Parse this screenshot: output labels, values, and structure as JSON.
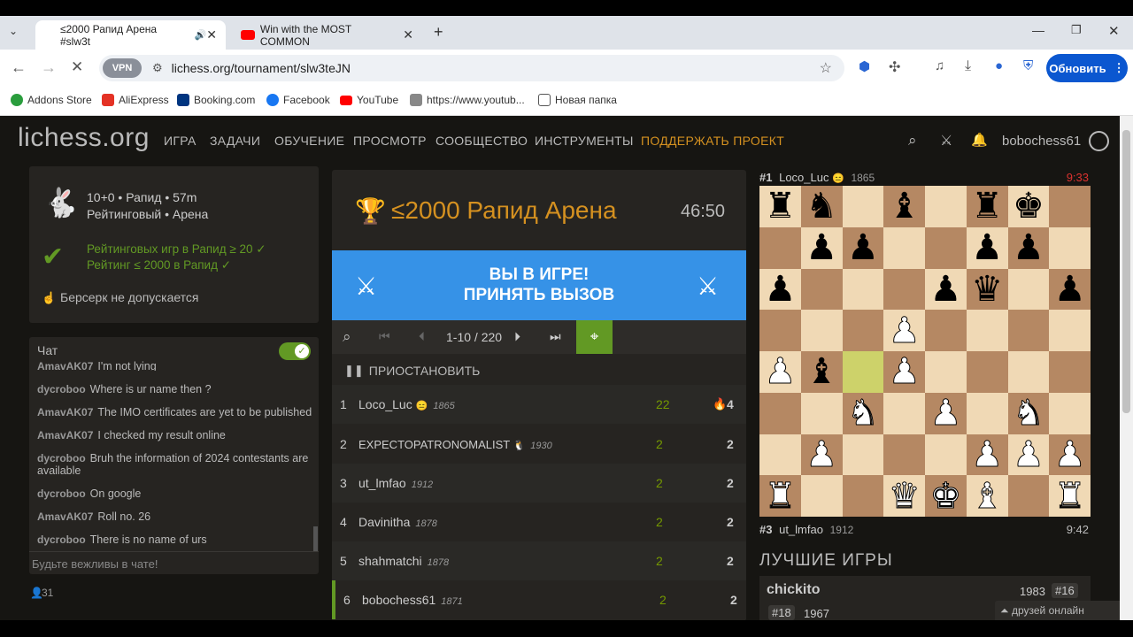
{
  "browser": {
    "tabs": [
      {
        "label": "≤2000 Рапид Арена #slw3t",
        "active": true
      },
      {
        "label": "Win with the MOST COMMON",
        "active": false
      }
    ],
    "url": "lichess.org/tournament/slw3teJN",
    "vpn": "VPN",
    "update_label": "Обновить",
    "bookmarks": [
      {
        "label": "Addons Store",
        "color": "#2a9d3d"
      },
      {
        "label": "AliExpress",
        "color": "#e43225"
      },
      {
        "label": "Booking.com",
        "color": "#003580"
      },
      {
        "label": "Facebook",
        "color": "#1877f2"
      },
      {
        "label": "YouTube",
        "color": "#ff0000"
      },
      {
        "label": "https://www.youtub...",
        "color": "#888888"
      },
      {
        "label": "Новая папка",
        "color": "#555555"
      }
    ]
  },
  "lichess": {
    "logo": "lichess",
    "logo_tld": ".org",
    "menu": [
      "ИГРА",
      "ЗАДАЧИ",
      "ОБУЧЕНИЕ",
      "ПРОСМОТР",
      "СООБЩЕСТВО",
      "ИНСТРУМЕНТЫ",
      "ПОДДЕРЖАТЬ ПРОЕКТ"
    ],
    "username": "bobochess61",
    "info": {
      "line1": "10+0 • Рапид • 57m",
      "line2": "Рейтинговый • Арена",
      "cond1": "Рейтинговых игр в Рапид ≥ 20 ✓",
      "cond2": "Рейтинг ≤ 2000 в Рапид ✓",
      "berserk": "Берсерк не допускается"
    },
    "chat": {
      "title": "Чат",
      "messages": [
        {
          "user": "AmavAK07",
          "text": "I'm not lying"
        },
        {
          "user": "dycroboo",
          "text": "Where is ur name then ?"
        },
        {
          "user": "AmavAK07",
          "text": "The IMO certificates are yet to be published"
        },
        {
          "user": "AmavAK07",
          "text": "I checked my result online"
        },
        {
          "user": "dycroboo",
          "text": "Bruh the information of 2024 contestants are"
        },
        {
          "user": "",
          "text": "available"
        },
        {
          "user": "dycroboo",
          "text": "On google"
        },
        {
          "user": "AmavAK07",
          "text": "Roll no. 26"
        },
        {
          "user": "dycroboo",
          "text": "There is no name of urs"
        }
      ],
      "placeholder": "Будьте вежливы в чате!",
      "spectators": "31"
    },
    "tournament": {
      "title": "≤2000 Рапид Арена",
      "clock": "46:50",
      "banner1": "ВЫ В ИГРЕ!",
      "banner2": "ПРИНЯТЬ ВЫЗОВ",
      "pager": "1-10 / 220",
      "pause": "ПРИОСТАНОВИТЬ",
      "standings": [
        {
          "rank": "1",
          "name": "Loco_Luc",
          "rating": "1865",
          "scores": "22",
          "total": "4",
          "fire": true
        },
        {
          "rank": "2",
          "name": "EXPECTOPATRONOMALIST",
          "rating": "1930",
          "scores": "2",
          "total": "2"
        },
        {
          "rank": "3",
          "name": "ut_lmfao",
          "rating": "1912",
          "scores": "2",
          "total": "2"
        },
        {
          "rank": "4",
          "name": "Davinitha",
          "rating": "1878",
          "scores": "2",
          "total": "2"
        },
        {
          "rank": "5",
          "name": "shahmatchi",
          "rating": "1878",
          "scores": "2",
          "total": "2"
        },
        {
          "rank": "6",
          "name": "bobochess61",
          "rating": "1871",
          "scores": "2",
          "total": "2"
        }
      ]
    },
    "game": {
      "top_rank": "#1",
      "top_name": "Loco_Luc",
      "top_rating": "1865",
      "top_clock": "9:33",
      "bot_rank": "#3",
      "bot_name": "ut_lmfao",
      "bot_rating": "1912",
      "bot_clock": "9:42",
      "best_games": "ЛУЧШИЕ ИГРЫ",
      "bg_player": "chickito",
      "bg_rating": "1983",
      "bg_rank": "#16",
      "bg2_rank": "#18",
      "bg2_rating": "1967",
      "friends": "друзей онлайн"
    }
  }
}
